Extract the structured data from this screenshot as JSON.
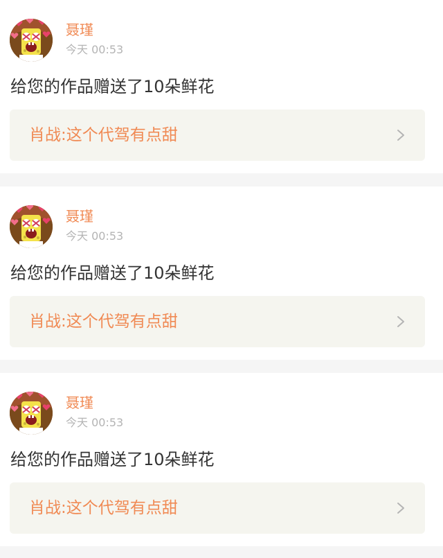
{
  "notifications": [
    {
      "user": "聂瑾",
      "time": "今天 00:53",
      "message": "给您的作品赠送了10朵鲜花",
      "work_title": "肖战:这个代驾有点甜",
      "avatar_icon": "spongebob-hearts-avatar",
      "chevron_icon": "chevron-right-icon"
    },
    {
      "user": "聂瑾",
      "time": "今天 00:53",
      "message": "给您的作品赠送了10朵鲜花",
      "work_title": "肖战:这个代驾有点甜",
      "avatar_icon": "spongebob-hearts-avatar",
      "chevron_icon": "chevron-right-icon"
    },
    {
      "user": "聂瑾",
      "time": "今天 00:53",
      "message": "给您的作品赠送了10朵鲜花",
      "work_title": "肖战:这个代驾有点甜",
      "avatar_icon": "spongebob-hearts-avatar",
      "chevron_icon": "chevron-right-icon"
    }
  ],
  "colors": {
    "accent": "#f08a54",
    "timestamp": "#b4b4b4",
    "message": "#333333",
    "link_background": "#f5f5ef",
    "page_background": "#f5f5f5"
  }
}
